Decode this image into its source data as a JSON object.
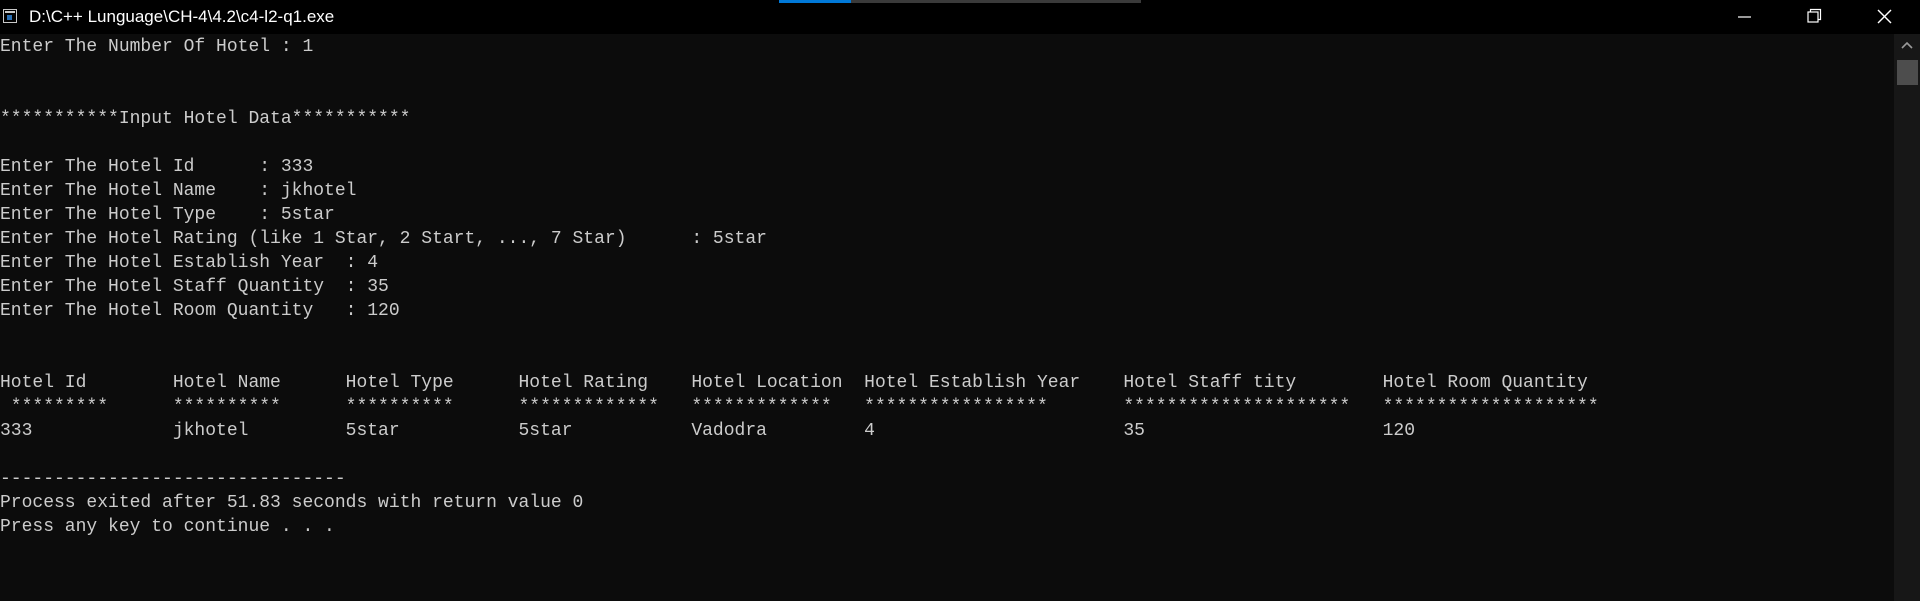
{
  "window": {
    "title": "D:\\C++ Lunguage\\CH-4\\4.2\\c4-l2-q1.exe"
  },
  "console": {
    "lines": [
      "Enter The Number Of Hotel : 1",
      "",
      "",
      "***********Input Hotel Data***********",
      "",
      "Enter The Hotel Id      : 333",
      "Enter The Hotel Name    : jkhotel",
      "Enter The Hotel Type    : 5star",
      "Enter The Hotel Rating (like 1 Star, 2 Start, ..., 7 Star)      : 5star",
      "Enter The Hotel Establish Year  : 4",
      "Enter The Hotel Staff Quantity  : 35",
      "Enter The Hotel Room Quantity   : 120",
      "",
      "",
      "Hotel Id        Hotel Name      Hotel Type      Hotel Rating    Hotel Location  Hotel Establish Year    Hotel Staff tity        Hotel Room Quantity",
      " *********      **********      **********      *************   *************   *****************       *********************   ********************",
      "333             jkhotel         5star           5star           Vadodra         4                       35                      120",
      "",
      "--------------------------------",
      "Process exited after 51.83 seconds with return value 0",
      "Press any key to continue . . ."
    ]
  }
}
